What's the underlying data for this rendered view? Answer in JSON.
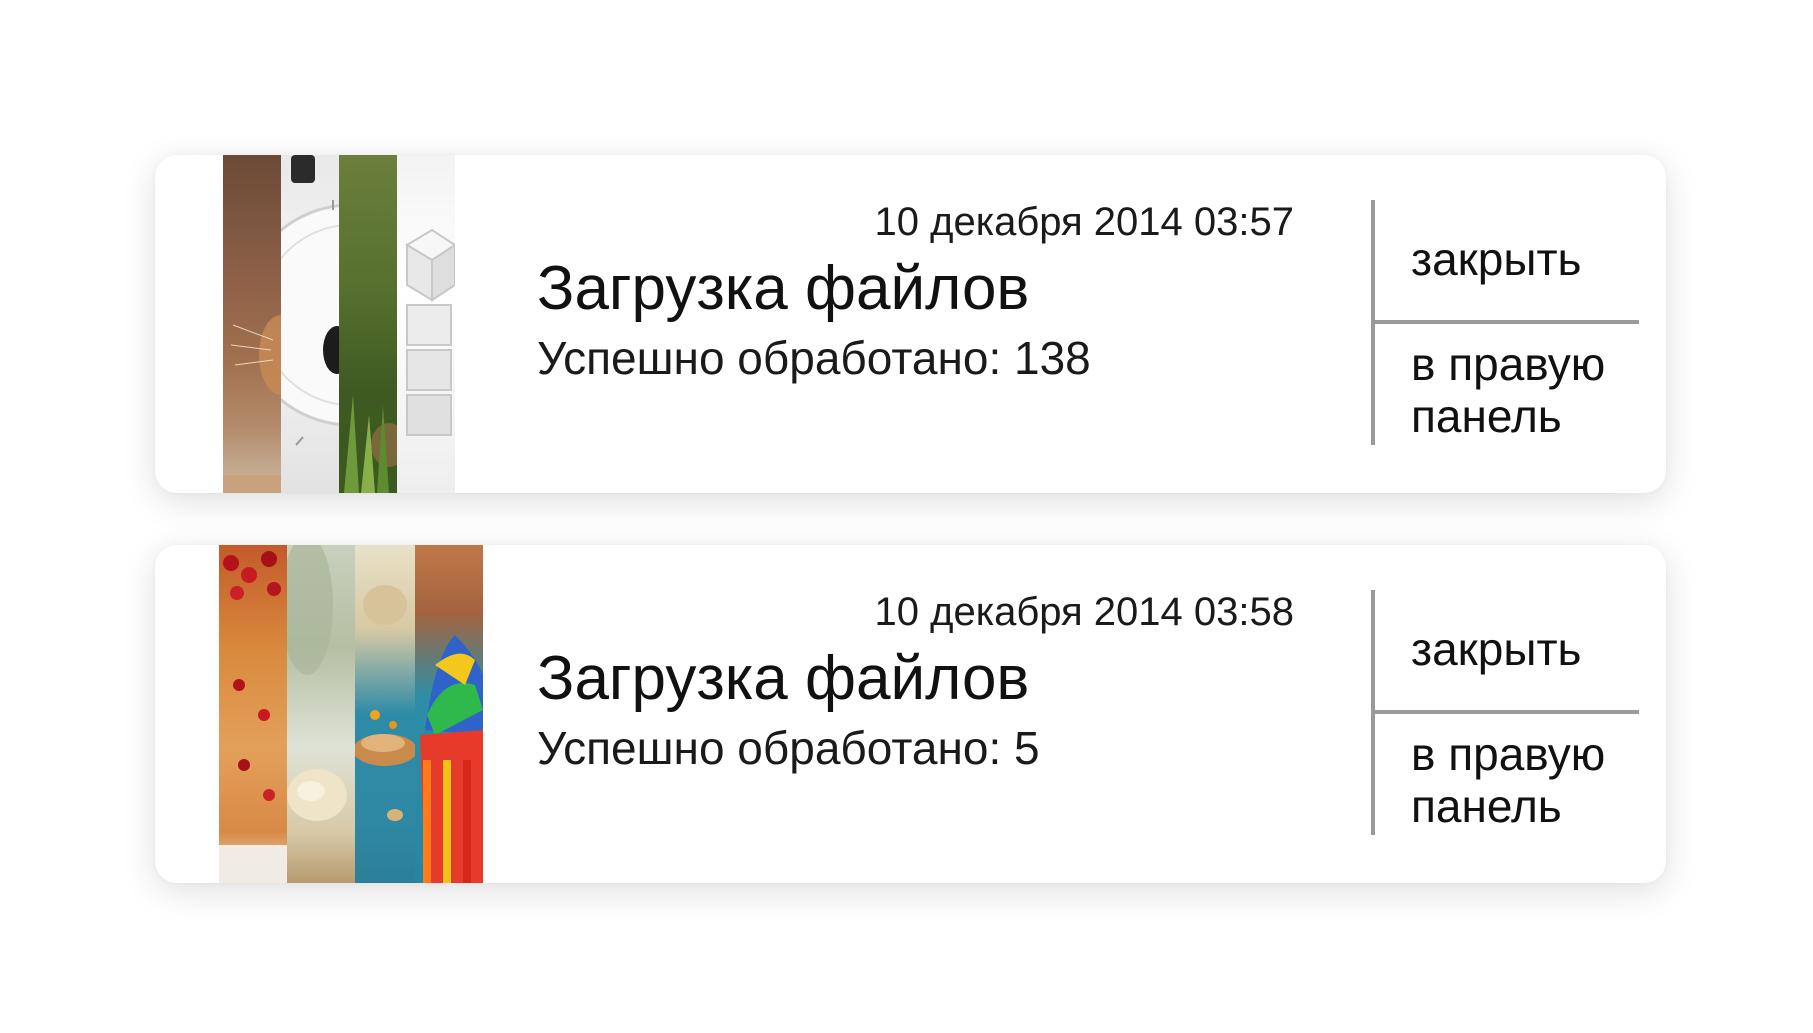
{
  "notifications": [
    {
      "timestamp": "10 декабря 2014 03:57",
      "title": "Загрузка файлов",
      "subtitle": "Успешно обработано: 138",
      "close_label": "закрыть",
      "panel_label": "в правую панель",
      "thumbnails": [
        "cat-photo",
        "clock-photo",
        "grass-photo",
        "cubes-photo"
      ]
    },
    {
      "timestamp": "10 декабря 2014 03:58",
      "title": "Загрузка файлов",
      "subtitle": "Успешно обработано: 5",
      "close_label": "закрыть",
      "panel_label": "в правую панель",
      "thumbnails": [
        "cherry-pie-photo",
        "bread-photo",
        "toast-photo",
        "cupcake-photo"
      ]
    }
  ]
}
